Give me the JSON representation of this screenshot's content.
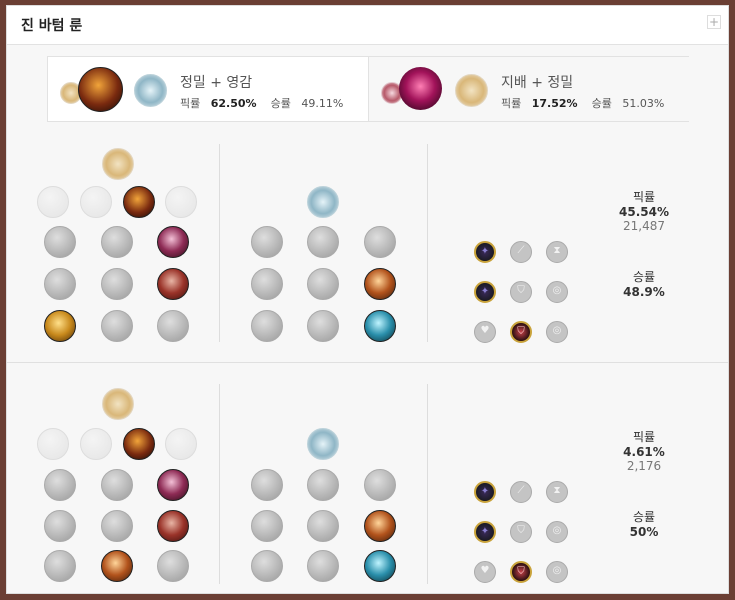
{
  "panel": {
    "title": "진 바텀 룬",
    "plus": "+"
  },
  "summary": [
    {
      "trees": "정밀 + 영감",
      "pick_label": "픽률",
      "pick_value": "62.50%",
      "win_label": "승률",
      "win_value": "49.11%"
    },
    {
      "trees": "지배 + 정밀",
      "pick_label": "픽률",
      "pick_value": "17.52%",
      "win_label": "승률",
      "win_value": "51.03%"
    }
  ],
  "builds": [
    {
      "pick_label": "픽률",
      "pick_value": "45.54%",
      "games": "21,487",
      "win_label": "승률",
      "win_value": "48.9%"
    },
    {
      "pick_label": "픽률",
      "pick_value": "4.61%",
      "games": "2,176",
      "win_label": "승률",
      "win_value": "50%"
    }
  ],
  "shard_glyphs": {
    "adaptive": "✦",
    "attack_speed": "⟋",
    "cdr": "⧗",
    "armor": "⛉",
    "mr": "◎",
    "health": "♥"
  }
}
